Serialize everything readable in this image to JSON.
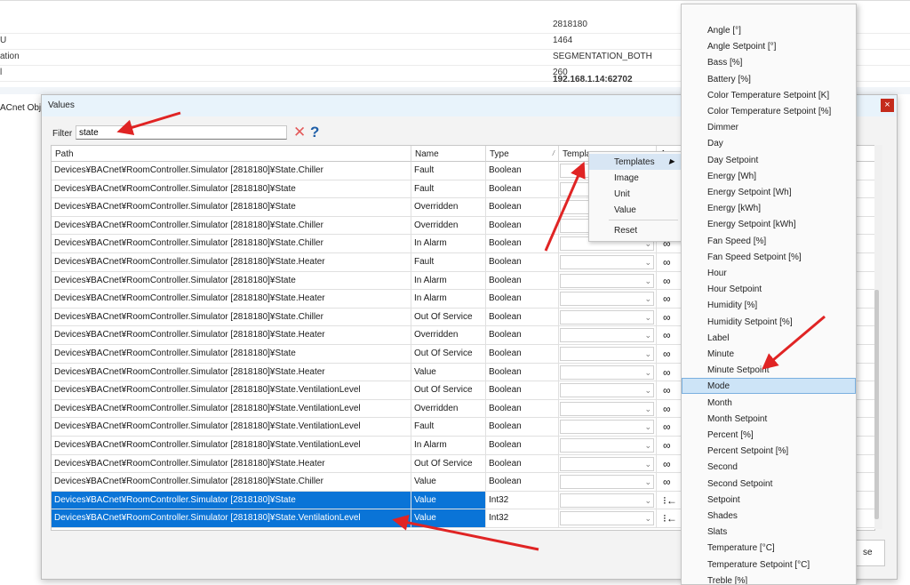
{
  "background": {
    "rows": [
      {
        "label": "",
        "value": "2818180"
      },
      {
        "label": "U",
        "value": "1464"
      },
      {
        "label": "ation",
        "value": "SEGMENTATION_BOTH"
      },
      {
        "label": "l",
        "value": "260"
      },
      {
        "label": "",
        "value": "192.168.1.14:62702"
      }
    ],
    "side_label": "ACnet Obje"
  },
  "dialog": {
    "title": "Values",
    "close_glyph": "×",
    "filter_label": "Filter",
    "filter_value": "state",
    "clear_glyph": "✕",
    "help_glyph": "?",
    "close_button_label": "se"
  },
  "table": {
    "headers": {
      "path": "Path",
      "name": "Name",
      "type": "Type",
      "template": "Templa",
      "action": "A",
      "sort_glyph": "/"
    },
    "rows": [
      {
        "path": "Devices¥BACnet¥RoomController.Simulator [2818180]¥State.Chiller",
        "name": "Fault",
        "type": "Boolean",
        "icon": "link"
      },
      {
        "path": "Devices¥BACnet¥RoomController.Simulator [2818180]¥State",
        "name": "Fault",
        "type": "Boolean",
        "icon": "link"
      },
      {
        "path": "Devices¥BACnet¥RoomController.Simulator [2818180]¥State",
        "name": "Overridden",
        "type": "Boolean",
        "icon": "link"
      },
      {
        "path": "Devices¥BACnet¥RoomController.Simulator [2818180]¥State.Chiller",
        "name": "Overridden",
        "type": "Boolean",
        "icon": "link"
      },
      {
        "path": "Devices¥BACnet¥RoomController.Simulator [2818180]¥State.Chiller",
        "name": "In Alarm",
        "type": "Boolean",
        "icon": "link"
      },
      {
        "path": "Devices¥BACnet¥RoomController.Simulator [2818180]¥State.Heater",
        "name": "Fault",
        "type": "Boolean",
        "icon": "link"
      },
      {
        "path": "Devices¥BACnet¥RoomController.Simulator [2818180]¥State",
        "name": "In Alarm",
        "type": "Boolean",
        "icon": "link"
      },
      {
        "path": "Devices¥BACnet¥RoomController.Simulator [2818180]¥State.Heater",
        "name": "In Alarm",
        "type": "Boolean",
        "icon": "link"
      },
      {
        "path": "Devices¥BACnet¥RoomController.Simulator [2818180]¥State.Chiller",
        "name": "Out Of Service",
        "type": "Boolean",
        "icon": "link"
      },
      {
        "path": "Devices¥BACnet¥RoomController.Simulator [2818180]¥State.Heater",
        "name": "Overridden",
        "type": "Boolean",
        "icon": "link"
      },
      {
        "path": "Devices¥BACnet¥RoomController.Simulator [2818180]¥State",
        "name": "Out Of Service",
        "type": "Boolean",
        "icon": "link"
      },
      {
        "path": "Devices¥BACnet¥RoomController.Simulator [2818180]¥State.Heater",
        "name": "Value",
        "type": "Boolean",
        "icon": "link"
      },
      {
        "path": "Devices¥BACnet¥RoomController.Simulator [2818180]¥State.VentilationLevel",
        "name": "Out Of Service",
        "type": "Boolean",
        "icon": "link"
      },
      {
        "path": "Devices¥BACnet¥RoomController.Simulator [2818180]¥State.VentilationLevel",
        "name": "Overridden",
        "type": "Boolean",
        "icon": "link"
      },
      {
        "path": "Devices¥BACnet¥RoomController.Simulator [2818180]¥State.VentilationLevel",
        "name": "Fault",
        "type": "Boolean",
        "icon": "link"
      },
      {
        "path": "Devices¥BACnet¥RoomController.Simulator [2818180]¥State.VentilationLevel",
        "name": "In Alarm",
        "type": "Boolean",
        "icon": "link"
      },
      {
        "path": "Devices¥BACnet¥RoomController.Simulator [2818180]¥State.Heater",
        "name": "Out Of Service",
        "type": "Boolean",
        "icon": "link"
      },
      {
        "path": "Devices¥BACnet¥RoomController.Simulator [2818180]¥State.Chiller",
        "name": "Value",
        "type": "Boolean",
        "icon": "link"
      },
      {
        "path": "Devices¥BACnet¥RoomController.Simulator [2818180]¥State",
        "name": "Value",
        "type": "Int32",
        "icon": "arrow",
        "selected": true
      },
      {
        "path": "Devices¥BACnet¥RoomController.Simulator [2818180]¥State.VentilationLevel",
        "name": "Value",
        "type": "Int32",
        "icon": "arrow",
        "selected": true
      }
    ]
  },
  "context_menu": {
    "items": [
      "Templates",
      "Image",
      "Unit",
      "Value",
      "Reset"
    ],
    "submenu_glyph": "▶"
  },
  "template_submenu": {
    "items": [
      "Angle [°]",
      "Angle Setpoint [°]",
      "Bass [%]",
      "Battery [%]",
      "Color Temperature Setpoint [K]",
      "Color Temperature Setpoint [%]",
      "Dimmer",
      "Day",
      "Day Setpoint",
      "Energy [Wh]",
      "Energy Setpoint [Wh]",
      "Energy [kWh]",
      "Energy Setpoint [kWh]",
      "Fan Speed [%]",
      "Fan Speed Setpoint [%]",
      "Hour",
      "Hour Setpoint",
      "Humidity [%]",
      "Humidity Setpoint [%]",
      "Label",
      "Minute",
      "Minute Setpoint",
      "Mode",
      "Month",
      "Month Setpoint",
      "Percent [%]",
      "Percent Setpoint [%]",
      "Second",
      "Second Setpoint",
      "Setpoint",
      "Shades",
      "Slats",
      "Temperature [°C]",
      "Temperature Setpoint [°C]",
      "Treble [%]"
    ],
    "highlighted": "Mode"
  },
  "icons": {
    "link_glyph": "∞",
    "arrow_glyph": "⁝←",
    "combo_glyph": "⌄"
  },
  "colors": {
    "selection": "#0a74d7",
    "annotation_arrow": "#e02424",
    "close_button": "#c42b1c"
  }
}
